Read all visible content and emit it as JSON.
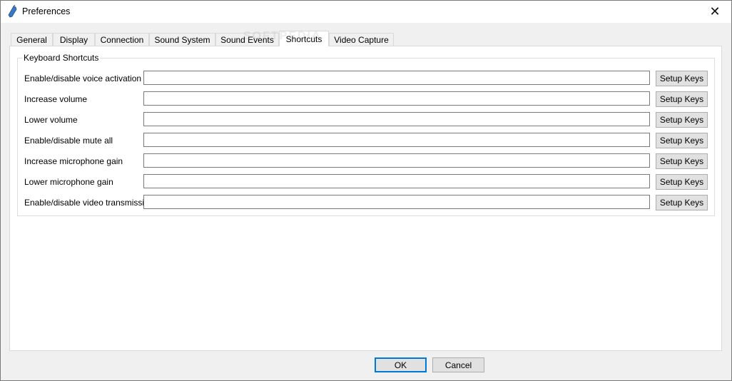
{
  "window": {
    "title": "Preferences",
    "icon": "app-icon",
    "close_glyph": "✕"
  },
  "tabs": [
    {
      "label": "General",
      "active": false
    },
    {
      "label": "Display",
      "active": false
    },
    {
      "label": "Connection",
      "active": false
    },
    {
      "label": "Sound System",
      "active": false
    },
    {
      "label": "Sound Events",
      "active": false
    },
    {
      "label": "Shortcuts",
      "active": true
    },
    {
      "label": "Video Capture",
      "active": false
    }
  ],
  "group": {
    "title": "Keyboard Shortcuts",
    "rows": [
      {
        "label": "Enable/disable voice activation",
        "value": "",
        "button": "Setup Keys"
      },
      {
        "label": "Increase volume",
        "value": "",
        "button": "Setup Keys"
      },
      {
        "label": "Lower volume",
        "value": "",
        "button": "Setup Keys"
      },
      {
        "label": "Enable/disable mute all",
        "value": "",
        "button": "Setup Keys"
      },
      {
        "label": "Increase microphone gain",
        "value": "",
        "button": "Setup Keys"
      },
      {
        "label": "Lower microphone gain",
        "value": "",
        "button": "Setup Keys"
      },
      {
        "label": "Enable/disable video transmission",
        "value": "",
        "button": "Setup Keys"
      }
    ]
  },
  "footer": {
    "ok_label": "OK",
    "cancel_label": "Cancel"
  },
  "watermark": "SOFTPEDIA",
  "colors": {
    "default_button_border": "#0078d7",
    "panel_bg": "#ffffff",
    "window_bg": "#f0f0f0"
  }
}
